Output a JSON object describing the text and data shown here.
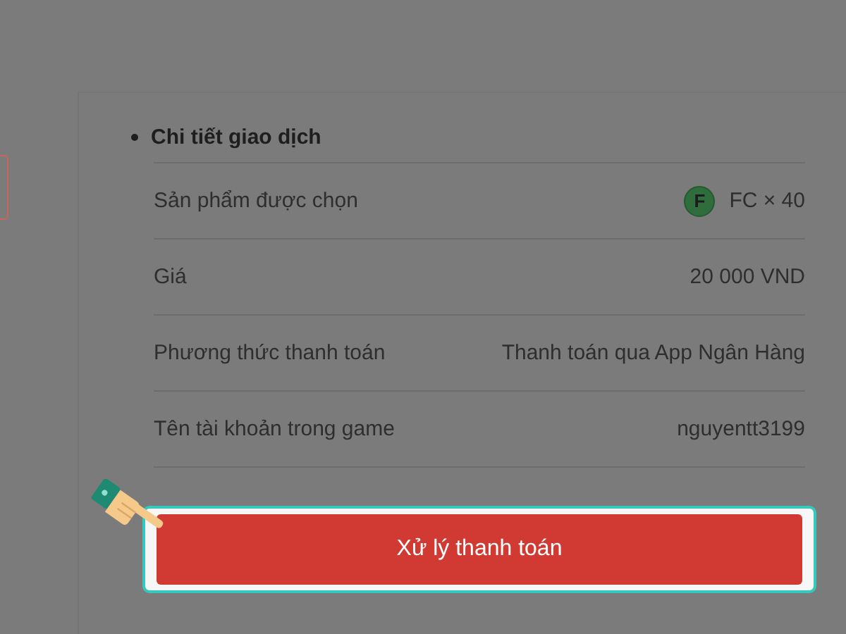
{
  "section": {
    "title": "Chi tiết giao dịch"
  },
  "rows": [
    {
      "label": "Sản phẩm được chọn",
      "value": "FC × 40",
      "icon_letter": "F"
    },
    {
      "label": "Giá",
      "value": "20 000 VND"
    },
    {
      "label": "Phương thức thanh toán",
      "value": "Thanh toán qua App Ngân Hàng"
    },
    {
      "label": "Tên tài khoản trong game",
      "value": "nguyentt3199"
    }
  ],
  "button": {
    "label": "Xử lý thanh toán",
    "highlighted": true
  }
}
